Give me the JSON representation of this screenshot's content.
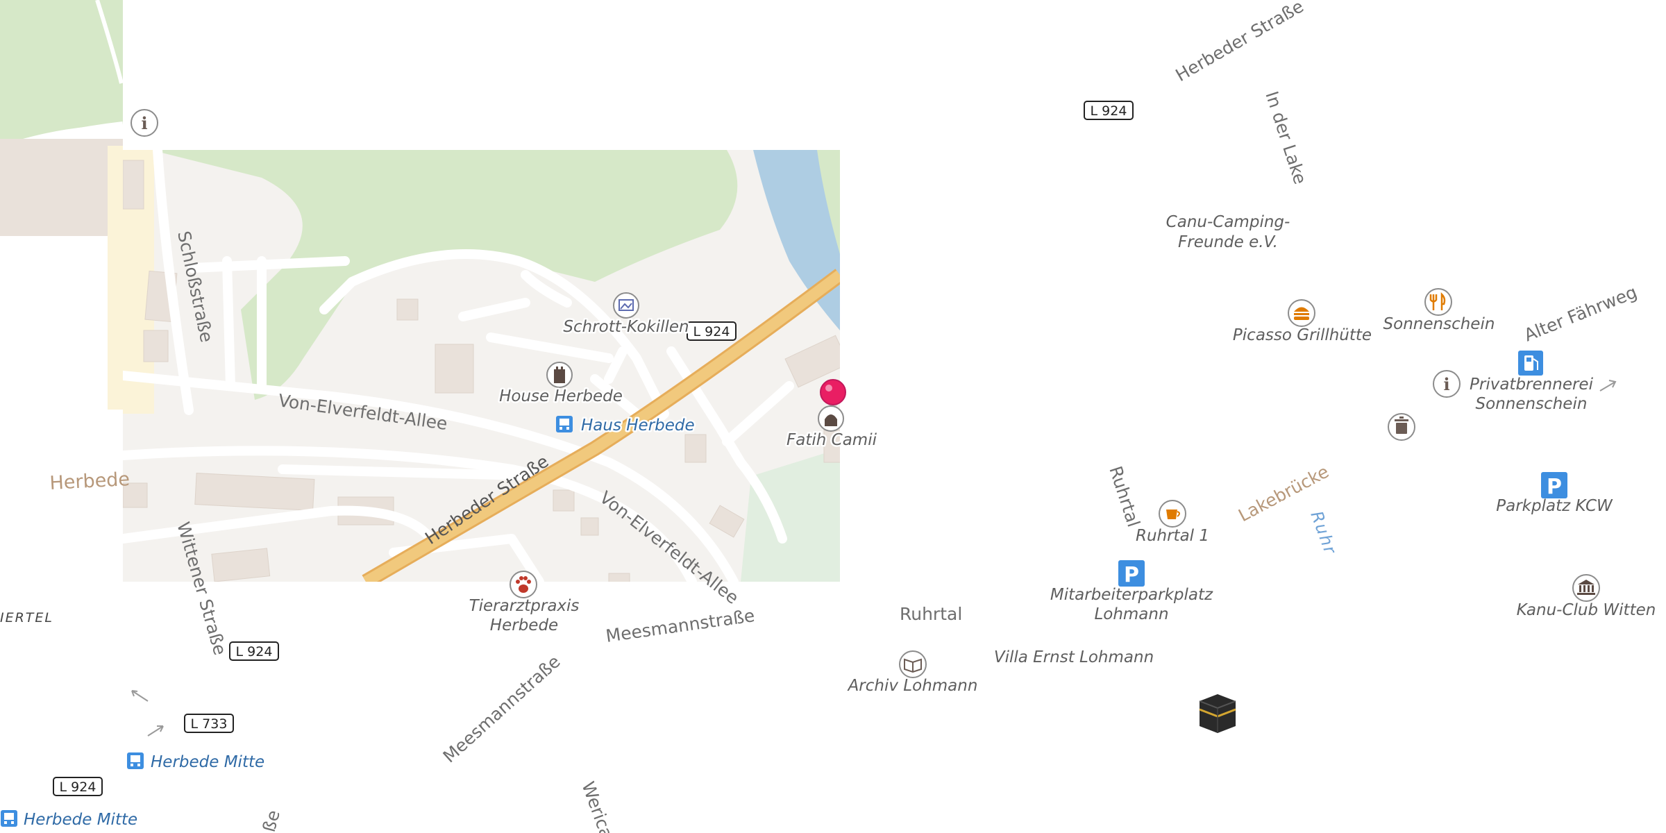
{
  "streets": {
    "herbeder_strasse": "Herbeder Straße",
    "von_elverfeldt_allee": "Von-Elverfeldt-Allee",
    "schlossstrasse": "Schloßstraße",
    "wittener_strasse": "Wittener Straße",
    "meesmannstrasse": "Meesmannstraße",
    "in_der_lake": "In der Lake",
    "ruhrtal": "Ruhrtal",
    "alter_faehrweg": "Alter Fährweg",
    "wericast": "Wericast",
    "strasse_fragment": "ße"
  },
  "places": {
    "herbede": "Herbede",
    "district": "IERTEL",
    "lakebruecke": "Lakebrücke",
    "ruhr": "Ruhr"
  },
  "pois": {
    "schrott_kokillen": "Schrott-Kokillen",
    "house_herbede": "House Herbede",
    "haus_herbede": "Haus Herbede",
    "fatih_camii": "Fatih Camii",
    "tierarztpraxis": [
      "Tierarztpraxis",
      "Herbede"
    ],
    "canu_camping": [
      "Canu-Camping-",
      "Freunde e.V."
    ],
    "picasso": "Picasso Grillhütte",
    "sonnenschein": "Sonnenschein",
    "privatbrennerei": [
      "Privatbrennerei",
      "Sonnenschein"
    ],
    "parkplatz_kcw": "Parkplatz KCW",
    "ruhrtal_1": "Ruhrtal 1",
    "mitarbeiter": [
      "Mitarbeiterparkplatz",
      "Lohmann"
    ],
    "villa": "Villa Ernst Lohmann",
    "archiv": "Archiv Lohmann",
    "kanu_club": "Kanu-Club Witten",
    "herbede_mitte": "Herbede Mitte"
  },
  "shields": {
    "l924": "L 924",
    "l733": "L 733"
  },
  "icons": [
    "info-icon",
    "gallery-icon",
    "castle-icon",
    "bus-stop-icon",
    "mosque-icon",
    "location-pin-icon",
    "veterinary-icon",
    "burger-icon",
    "restaurant-icon",
    "fuel-icon",
    "waste-bin-icon",
    "parking-icon",
    "cafe-icon",
    "library-icon",
    "museum-icon",
    "kaaba-icon",
    "arrow-icon"
  ],
  "colors": {
    "forest": "#d6e8c8",
    "water": "#aecde3",
    "motorway": "#f1c97d",
    "residential": "#fbf3d8",
    "building": "#e9e1da",
    "pin": "#e91e63",
    "transit_blue": "#3d8ee0",
    "parking_blue": "#3d8ee0",
    "food_orange": "#e07b00"
  }
}
